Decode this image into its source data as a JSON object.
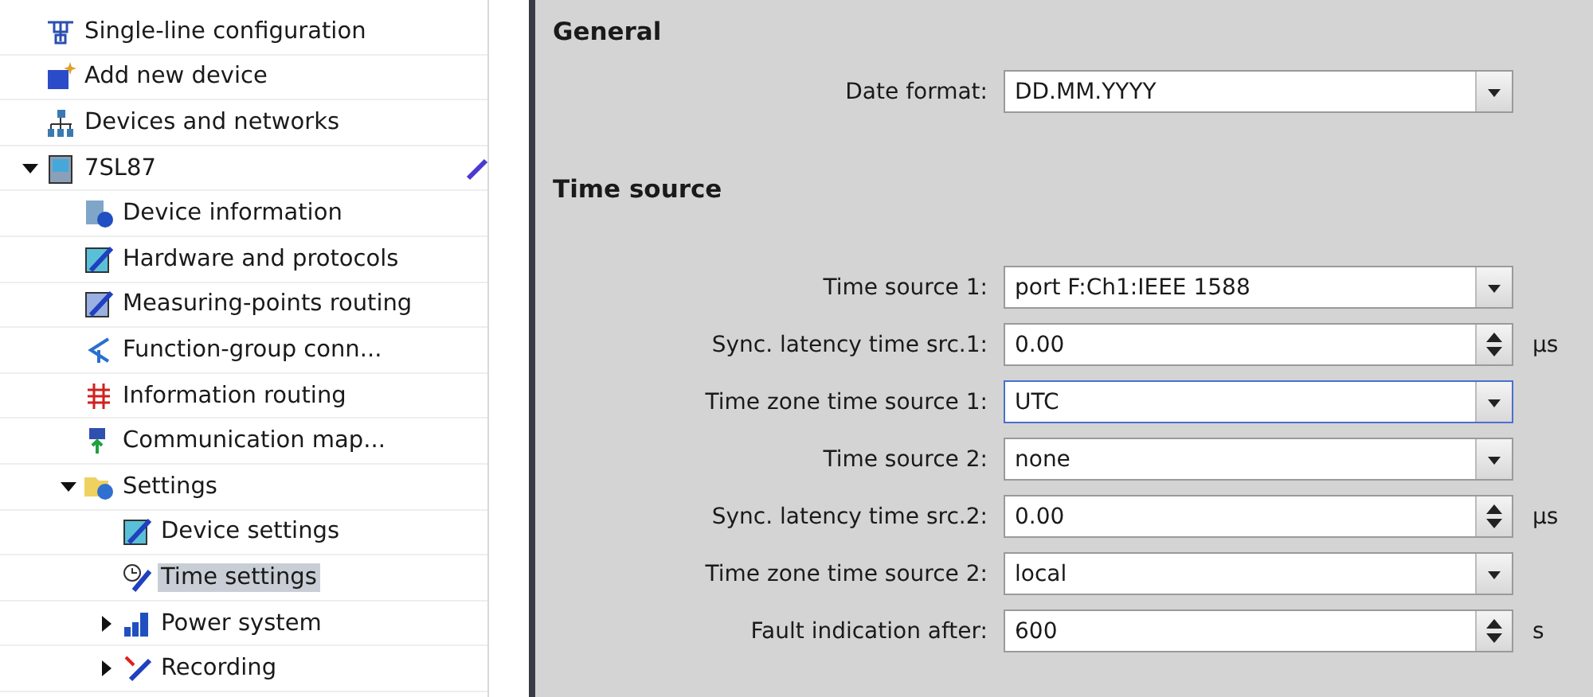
{
  "tree": [
    {
      "label": "Single-line configuration"
    },
    {
      "label": "Add new device"
    },
    {
      "label": "Devices and networks"
    },
    {
      "label": "7SL87",
      "expanded": true,
      "editable": true,
      "children": [
        {
          "label": "Device information"
        },
        {
          "label": "Hardware and protocols"
        },
        {
          "label": "Measuring-points routing"
        },
        {
          "label": "Function-group conn..."
        },
        {
          "label": "Information routing"
        },
        {
          "label": "Communication map..."
        },
        {
          "label": "Settings",
          "expanded": true,
          "children": [
            {
              "label": "Device settings",
              "selected": false
            },
            {
              "label": "Time settings",
              "selected": true
            },
            {
              "label": "Power system",
              "expanded": false
            },
            {
              "label": "Recording",
              "expanded": false
            }
          ]
        }
      ]
    }
  ],
  "sections": [
    {
      "title": "General",
      "fields": [
        {
          "label": "Date format:",
          "kind": "dropdown",
          "value": "DD.MM.YYYY",
          "focused": false
        }
      ]
    },
    {
      "title": "Time source",
      "fields": [
        {
          "label": "Time source 1:",
          "kind": "dropdown",
          "value": "port F:Ch1:IEEE 1588",
          "focused": false
        },
        {
          "label": "Sync. latency time src.1:",
          "kind": "spinner",
          "value": "0.00",
          "unit": "µs",
          "focused": false
        },
        {
          "label": "Time zone time source 1:",
          "kind": "dropdown",
          "value": "UTC",
          "focused": true
        },
        {
          "label": "Time source 2:",
          "kind": "dropdown",
          "value": "none",
          "focused": false
        },
        {
          "label": "Sync. latency time src.2:",
          "kind": "spinner",
          "value": "0.00",
          "unit": "µs",
          "focused": false
        },
        {
          "label": "Time zone time source 2:",
          "kind": "dropdown",
          "value": "local",
          "focused": false
        },
        {
          "label": "Fault indication after:",
          "kind": "spinner",
          "value": "600",
          "unit": "s",
          "focused": false
        }
      ]
    }
  ]
}
